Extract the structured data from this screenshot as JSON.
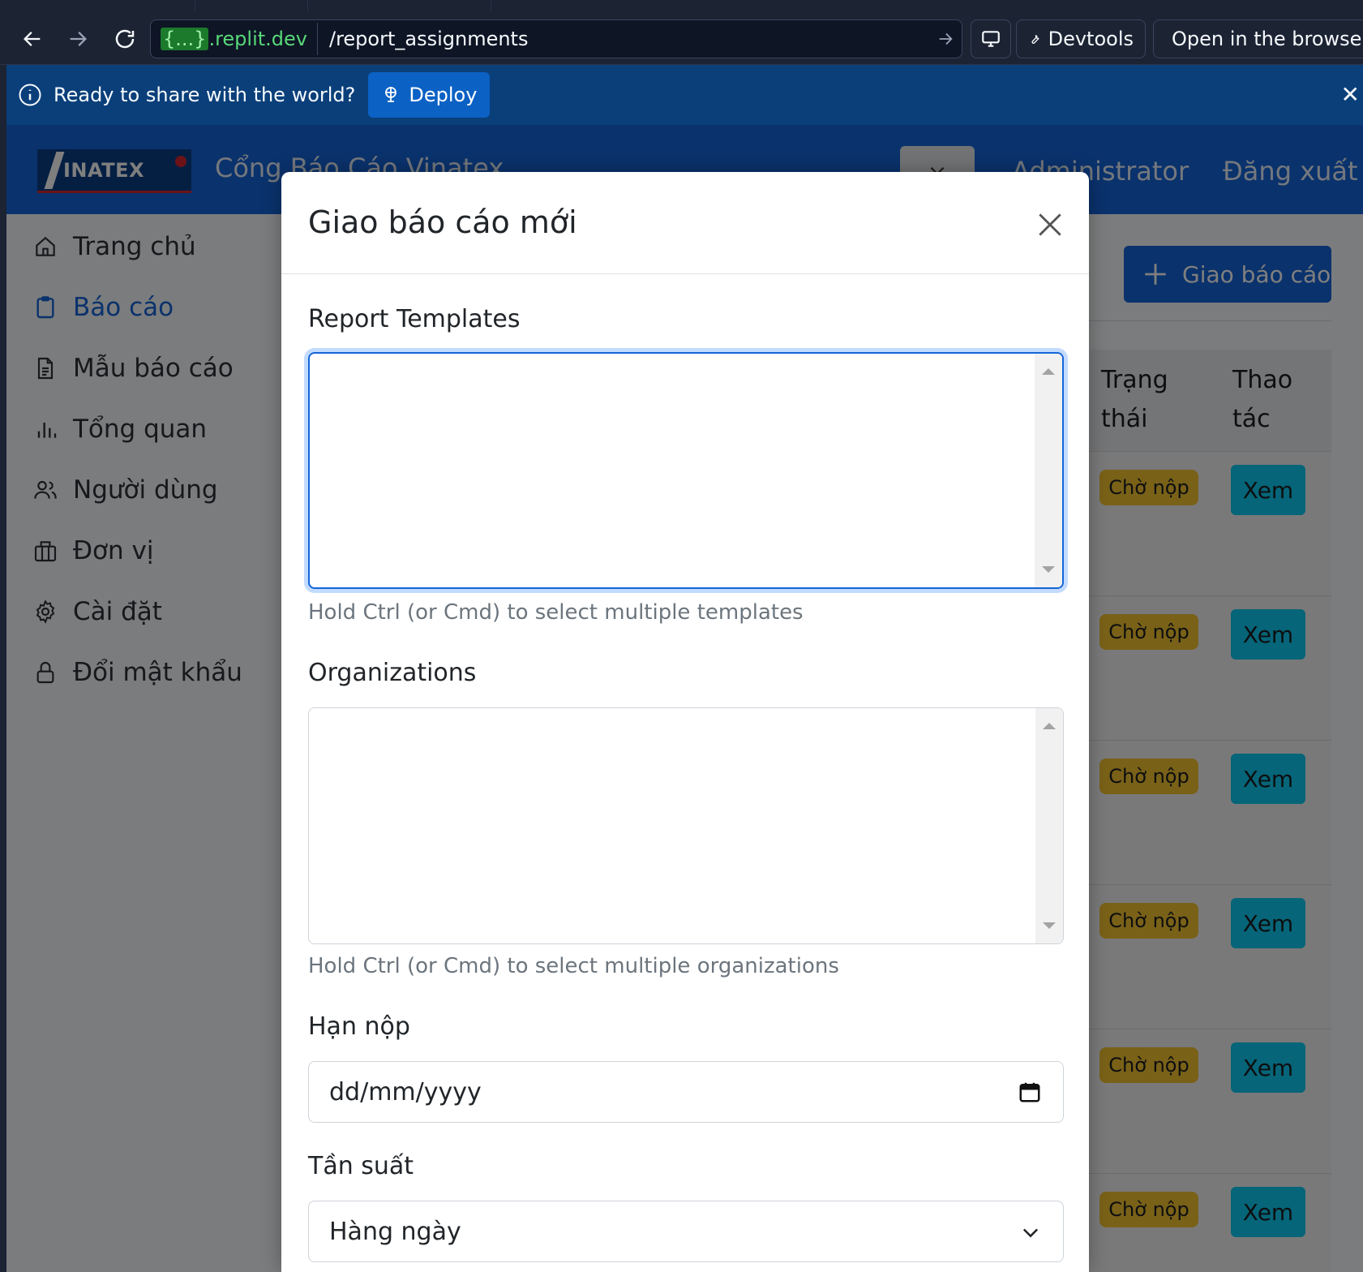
{
  "browser": {
    "url_host": ".replit.dev",
    "url_host_prefix": "{...}",
    "url_path": "/report_assignments",
    "devtools_label": "Devtools",
    "open_browser_label": "Open in the browser"
  },
  "deploy_bar": {
    "message": "Ready to share with the world?",
    "deploy_label": "Deploy",
    "close_symbol": "✕"
  },
  "header": {
    "logo_text": "INATEX",
    "app_title": "Cổng Báo Cáo Vinatex",
    "user_label": "Administrator",
    "logout_label": "Đăng xuất"
  },
  "sidebar": {
    "items": [
      {
        "label": "Trang chủ",
        "icon": "home-icon"
      },
      {
        "label": "Báo cáo",
        "icon": "clipboard-icon",
        "active": true
      },
      {
        "label": "Mẫu báo cáo",
        "icon": "document-icon"
      },
      {
        "label": "Tổng quan",
        "icon": "bar-chart-icon"
      },
      {
        "label": "Người dùng",
        "icon": "users-icon"
      },
      {
        "label": "Đơn vị",
        "icon": "building-icon"
      },
      {
        "label": "Cài đặt",
        "icon": "gear-icon"
      },
      {
        "label": "Đổi mật khẩu",
        "icon": "lock-icon"
      }
    ]
  },
  "main": {
    "add_button_label": "Giao báo cáo",
    "table": {
      "columns": [
        "Trạng thái",
        "Thao tác"
      ],
      "rows": [
        {
          "status": "Chờ nộp",
          "action": "Xem"
        },
        {
          "status": "Chờ nộp",
          "action": "Xem"
        },
        {
          "status": "Chờ nộp",
          "action": "Xem"
        },
        {
          "status": "Chờ nộp",
          "action": "Xem"
        },
        {
          "status": "Chờ nộp",
          "action": "Xem"
        },
        {
          "status": "Chờ nộp",
          "action": "Xem"
        }
      ]
    }
  },
  "modal": {
    "title": "Giao báo cáo mới",
    "templates_label": "Report Templates",
    "templates_help": "Hold Ctrl (or Cmd) to select multiple templates",
    "organizations_label": "Organizations",
    "organizations_help": "Hold Ctrl (or Cmd) to select multiple organizations",
    "deadline_label": "Hạn nộp",
    "deadline_placeholder": "dd/mm/yyyy",
    "frequency_label": "Tần suất",
    "frequency_value": "Hàng ngày"
  },
  "colors": {
    "primary": "#1565d8",
    "badge_warning": "#f2c230",
    "button_info": "#0dcaf0",
    "deploy_bar": "#0a3f7a"
  }
}
